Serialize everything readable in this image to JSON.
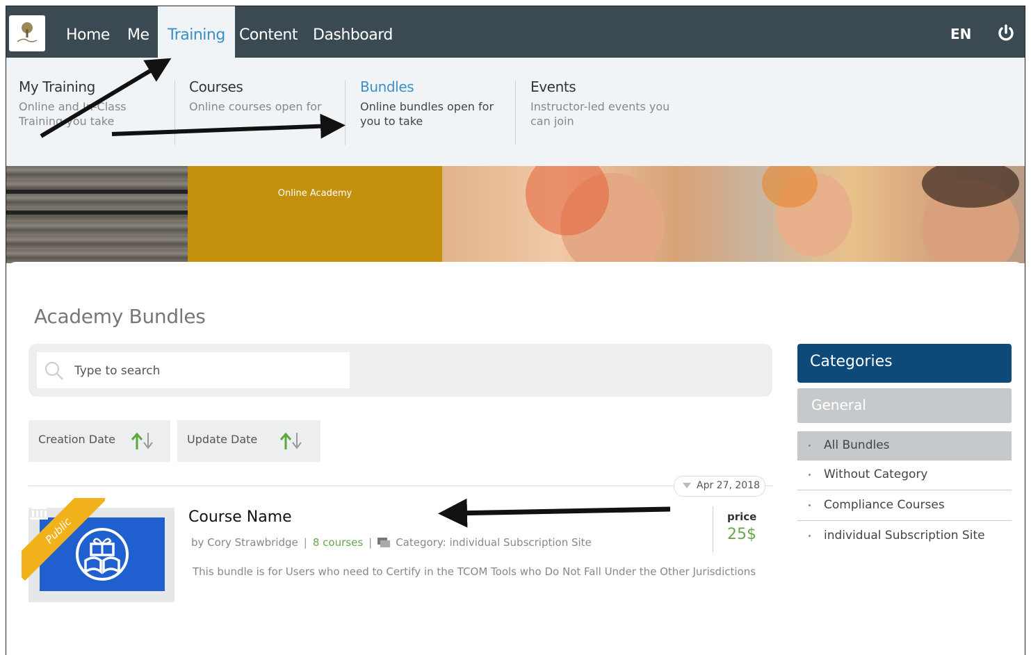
{
  "nav": {
    "items": [
      "Home",
      "Me",
      "Training",
      "Content",
      "Dashboard"
    ],
    "active": "Training",
    "lang": "EN"
  },
  "submenu": [
    {
      "title": "My Training",
      "desc1": "Online and In-Class",
      "desc2": "Training you take"
    },
    {
      "title": "Courses",
      "desc1": "Online courses open for",
      "desc2": ""
    },
    {
      "title": "Bundles",
      "desc1": "Online bundles open for",
      "desc2": "you to take"
    },
    {
      "title": "Events",
      "desc1": "Instructor-led events you",
      "desc2": "can join"
    }
  ],
  "banner": {
    "label": "Online Academy"
  },
  "page": {
    "title": "Academy Bundles",
    "search_placeholder": "Type to search"
  },
  "sort": {
    "creation": "Creation Date",
    "update": "Update Date"
  },
  "bundle": {
    "date": "Apr 27, 2018",
    "ribbon": "Public",
    "name": "Course Name",
    "author": "by Cory Strawbridge",
    "courses": "8 courses",
    "category": "Category: individual Subscription Site",
    "description": "This bundle is for Users who need to Certify in the TCOM Tools who Do Not Fall Under the Other Jurisdictions",
    "price_label": "price",
    "price_value": "25$"
  },
  "categories": {
    "header": "Categories",
    "group": "General",
    "items": [
      "All Bundles",
      "Without Category",
      "Compliance Courses",
      "individual Subscription Site"
    ]
  },
  "colors": {
    "nav_bg": "#3b4a52",
    "accent_blue": "#3a8fc6",
    "category_header": "#0d4a7a",
    "green": "#66a84b",
    "gold": "#c4900d"
  }
}
